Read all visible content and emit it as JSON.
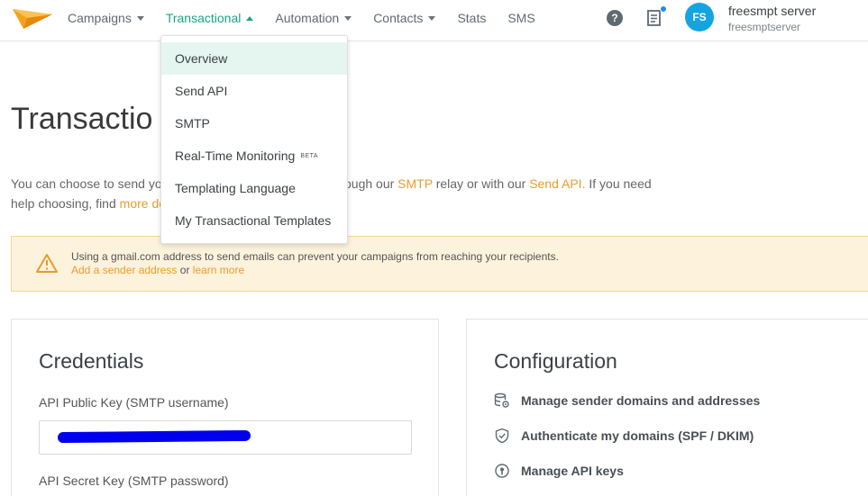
{
  "nav": {
    "items": [
      {
        "label": "Campaigns",
        "caret": "down"
      },
      {
        "label": "Transactional",
        "caret": "up",
        "active": true
      },
      {
        "label": "Automation",
        "caret": "down"
      },
      {
        "label": "Contacts",
        "caret": "down"
      },
      {
        "label": "Stats",
        "caret": ""
      },
      {
        "label": "SMS",
        "caret": ""
      }
    ],
    "help_icon": "?",
    "avatar_initials": "FS",
    "user_name": "freesmpt server",
    "user_account": "freesmptserver"
  },
  "dropdown": {
    "items": [
      {
        "label": "Overview",
        "selected": true
      },
      {
        "label": "Send API"
      },
      {
        "label": "SMTP"
      },
      {
        "label": "Real-Time Monitoring",
        "badge": "BETA"
      },
      {
        "label": "Templating Language"
      },
      {
        "label": "My Transactional Templates"
      }
    ]
  },
  "page": {
    "title": "Transactio",
    "intro_line1_start": "You can choose to send yo",
    "intro_line1_mid": "ough our",
    "smtp_link": "SMTP",
    "relay_text": "relay or with our",
    "send_api_link": "Send API.",
    "tail_text": "If you need",
    "intro_line2_start": "help choosing, find",
    "more_link": "more de"
  },
  "warning": {
    "text": "Using a gmail.com address to send emails can prevent your campaigns from reaching your recipients.",
    "link1": "Add a sender address",
    "or_text": "or",
    "link2": "learn more"
  },
  "credentials": {
    "title": "Credentials",
    "public_key_label": "API Public Key (SMTP username)",
    "secret_key_label": "API Secret Key (SMTP password)"
  },
  "configuration": {
    "title": "Configuration",
    "items": [
      {
        "label": "Manage sender domains and addresses",
        "icon": "database-gear-icon"
      },
      {
        "label": "Authenticate my domains (SPF / DKIM)",
        "icon": "shield-icon"
      },
      {
        "label": "Manage API keys",
        "icon": "key-icon"
      }
    ]
  },
  "colors": {
    "accent_green": "#17a683",
    "link_orange": "#e89c2e",
    "avatar_blue": "#14a5e0",
    "warning_bg": "#fdf2dc"
  }
}
